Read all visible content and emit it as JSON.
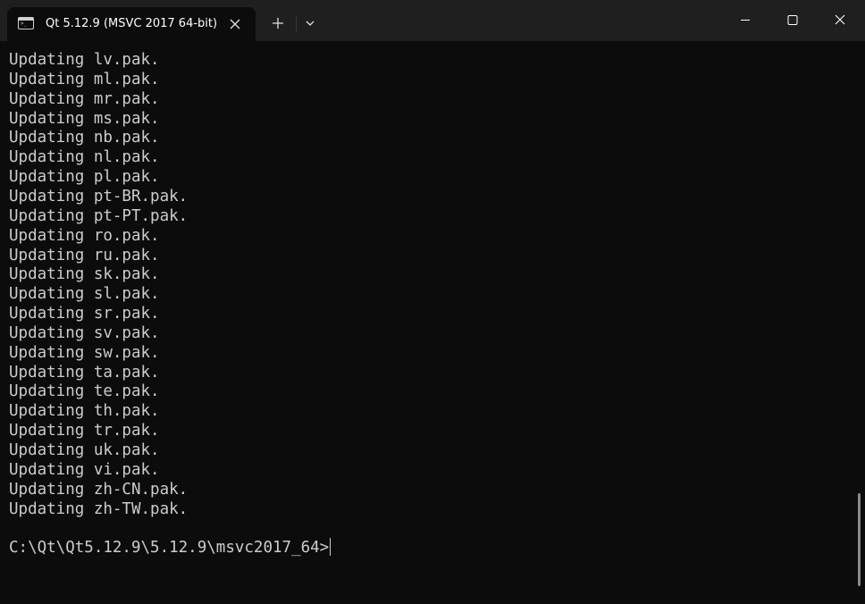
{
  "tab": {
    "title": "Qt 5.12.9 (MSVC 2017 64-bit)",
    "icon": "terminal-icon"
  },
  "toolbar": {
    "new_tab_icon": "plus-icon",
    "dropdown_icon": "chevron-down-icon"
  },
  "window_controls": {
    "minimize_icon": "minimize-icon",
    "maximize_icon": "maximize-icon",
    "close_icon": "close-icon"
  },
  "terminal": {
    "lines": [
      "Updating lv.pak.",
      "Updating ml.pak.",
      "Updating mr.pak.",
      "Updating ms.pak.",
      "Updating nb.pak.",
      "Updating nl.pak.",
      "Updating pl.pak.",
      "Updating pt-BR.pak.",
      "Updating pt-PT.pak.",
      "Updating ro.pak.",
      "Updating ru.pak.",
      "Updating sk.pak.",
      "Updating sl.pak.",
      "Updating sr.pak.",
      "Updating sv.pak.",
      "Updating sw.pak.",
      "Updating ta.pak.",
      "Updating te.pak.",
      "Updating th.pak.",
      "Updating tr.pak.",
      "Updating uk.pak.",
      "Updating vi.pak.",
      "Updating zh-CN.pak.",
      "Updating zh-TW.pak."
    ],
    "prompt": "C:\\Qt\\Qt5.12.9\\5.12.9\\msvc2017_64>"
  },
  "colors": {
    "background": "#0c0c0c",
    "titlebar": "#1f1f1f",
    "text": "#cccccc"
  }
}
